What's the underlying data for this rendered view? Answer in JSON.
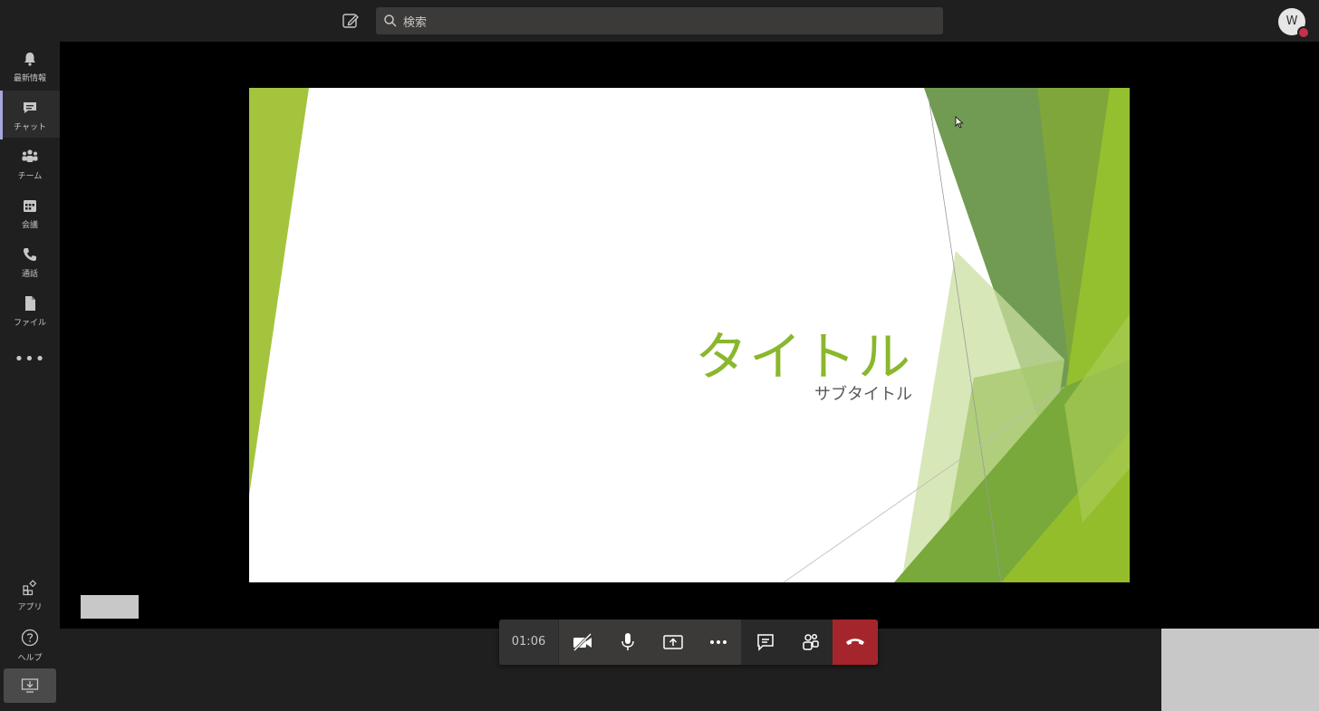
{
  "search": {
    "placeholder": "検索"
  },
  "account": {
    "initial": "W",
    "presence_color": "#c4314b"
  },
  "rail": {
    "items": [
      {
        "label": "最新情報",
        "icon": "bell-icon"
      },
      {
        "label": "チャット",
        "icon": "chat-icon",
        "active": true
      },
      {
        "label": "チーム",
        "icon": "teams-icon"
      },
      {
        "label": "会議",
        "icon": "calendar-icon"
      },
      {
        "label": "通話",
        "icon": "phone-icon"
      },
      {
        "label": "ファイル",
        "icon": "file-icon"
      }
    ],
    "more": "•••",
    "bottom": [
      {
        "label": "アプリ",
        "icon": "apps-icon"
      },
      {
        "label": "ヘルプ",
        "icon": "help-icon"
      }
    ],
    "download_icon": "download-icon"
  },
  "slide": {
    "title": "タイトル",
    "subtitle": "サブタイトル",
    "accent": "#8ab72d"
  },
  "call": {
    "timer": "01:06",
    "controls": [
      "camera-off-icon",
      "microphone-icon",
      "share-screen-icon",
      "more-icon",
      "chat-icon",
      "participants-icon",
      "hangup-icon"
    ],
    "hangup_color": "#a4262c"
  }
}
